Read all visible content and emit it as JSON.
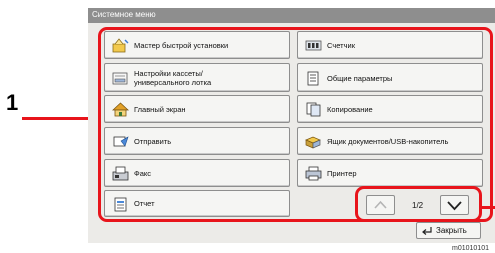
{
  "window": {
    "title": "Системное меню"
  },
  "menu": {
    "items": [
      {
        "label": "Мастер быстрой установки",
        "icon": "wizard-icon"
      },
      {
        "label": "Счетчик",
        "icon": "counter-icon"
      },
      {
        "label": "Настройки кассеты/ универсального лотка",
        "icon": "cassette-icon"
      },
      {
        "label": "Общие параметры",
        "icon": "document-settings-icon"
      },
      {
        "label": "Главный экран",
        "icon": "home-icon"
      },
      {
        "label": "Копирование",
        "icon": "copy-icon"
      },
      {
        "label": "Отправить",
        "icon": "send-icon"
      },
      {
        "label": "Ящик документов/USB-накопитель",
        "icon": "document-box-icon"
      },
      {
        "label": "Факс",
        "icon": "fax-icon"
      },
      {
        "label": "Принтер",
        "icon": "printer-icon"
      },
      {
        "label": "Отчет",
        "icon": "report-icon"
      }
    ]
  },
  "pager": {
    "page": "1/2"
  },
  "footer": {
    "close_label": "Закрыть",
    "image_code": "m01010101"
  },
  "callouts": {
    "menu_number": "1"
  },
  "colors": {
    "callout": "#e8141b",
    "title_bar": "#8e8e8e",
    "panel": "#ecebe8"
  }
}
